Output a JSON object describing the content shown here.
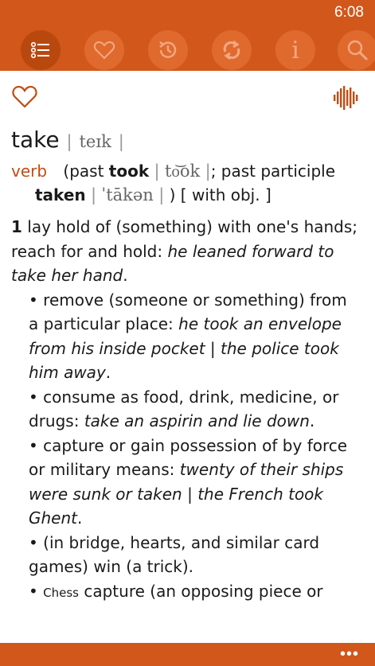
{
  "status": {
    "time": "6:08"
  },
  "toolbar": {
    "buttons": [
      {
        "name": "list",
        "active": true
      },
      {
        "name": "favorites"
      },
      {
        "name": "history"
      },
      {
        "name": "random"
      },
      {
        "name": "info",
        "label": "i"
      },
      {
        "name": "search"
      }
    ]
  },
  "entry": {
    "headword": "take",
    "pron_sep_left": "|",
    "pronunciation": "teɪk",
    "pron_sep_right": "|",
    "pos": "verb",
    "forms_prefix": "(past",
    "past": "took",
    "past_sep_left": "|",
    "past_pron": "to͝ok",
    "past_sep_right": "|",
    "past_participle_label": "; past participle",
    "past_participle": "taken",
    "pp_sep_left": "|",
    "pp_pron": "ˈtākən",
    "pp_sep_right": "|",
    "forms_suffix": ") [ with obj. ]",
    "sense_num": "1",
    "sense_text": "lay hold of (something) with one's hands; reach for and hold:",
    "sense_example": "he leaned forward to take her hand",
    "sense_example_end": ".",
    "sub1_text": "• remove (someone or something) from a particular place:",
    "sub1_example": "he took an envelope from his inside pocket | the police took him away",
    "sub1_end": ".",
    "sub2_text": "• consume as food, drink, medicine, or drugs:",
    "sub2_example": "take an aspirin and lie down",
    "sub2_end": ".",
    "sub3_text": "• capture or gain possession of by force or military means:",
    "sub3_example": "twenty of their ships were sunk or taken | the French took Ghent",
    "sub3_end": ".",
    "sub4_text": "• (in bridge, hearts, and similar card games) win (a trick).",
    "sub5_bullet": "•",
    "sub5_label": "Chess",
    "sub5_text": "capture (an opposing piece or"
  },
  "appbar": {
    "more": "•••"
  },
  "colors": {
    "accent": "#d2571a",
    "pos": "#c24c12"
  }
}
